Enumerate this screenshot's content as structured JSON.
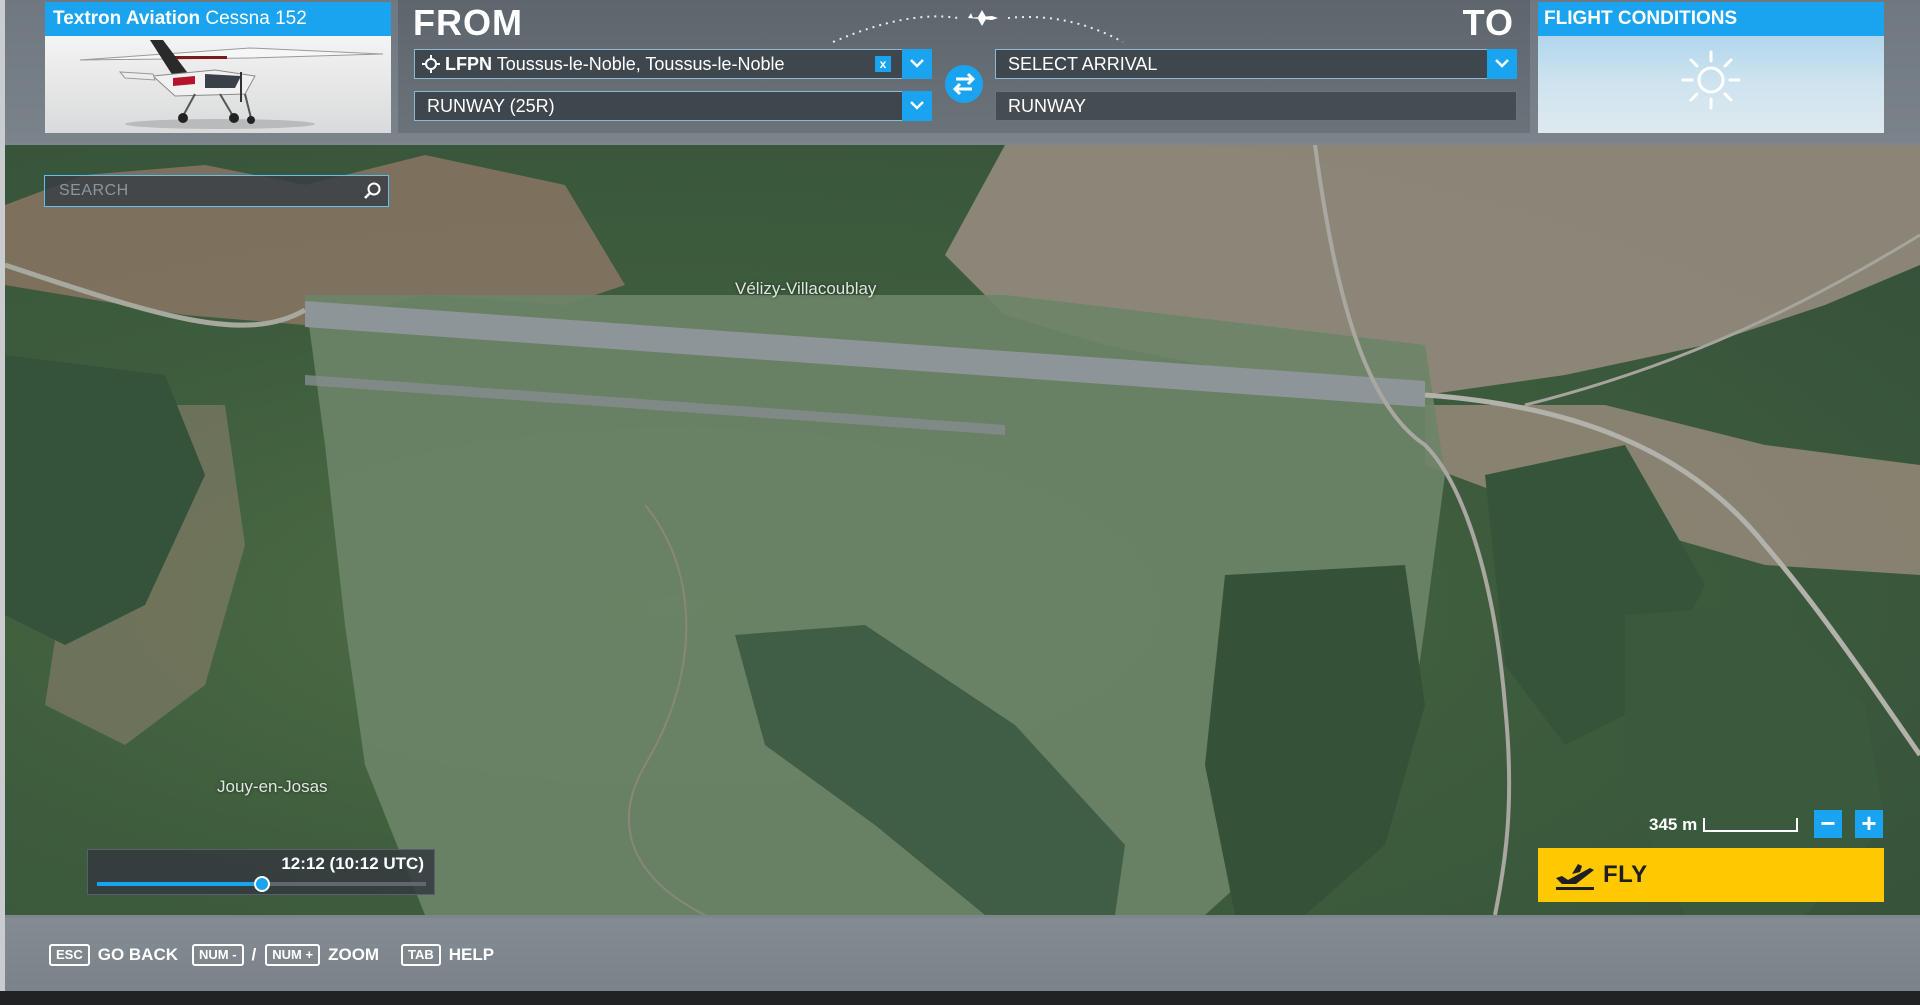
{
  "aircraft": {
    "brand": "Textron Aviation",
    "model": "Cessna 152"
  },
  "route": {
    "from_label": "FROM",
    "to_label": "TO",
    "departure": {
      "code": "LFPN",
      "name": "Toussus-le-Noble, Toussus-le-Noble",
      "clear_label": "x"
    },
    "departure_runway": "RUNWAY (25R)",
    "arrival_placeholder": "SELECT ARRIVAL",
    "arrival_runway": "RUNWAY"
  },
  "conditions": {
    "title": "FLIGHT CONDITIONS",
    "weather_icon": "sun-icon"
  },
  "map": {
    "search_placeholder": "SEARCH",
    "places": [
      "Vélizy-Villacoublay",
      "Jouy-en-Josas"
    ],
    "time_text": "12:12 (10:12 UTC)",
    "time_progress": 0.5,
    "scale_text": "345 m",
    "zoom_out_label": "−",
    "zoom_in_label": "+"
  },
  "fly": {
    "label": "FLY"
  },
  "hints": {
    "back_key": "ESC",
    "back_label": "GO BACK",
    "zoom_out_key": "NUM -",
    "zoom_sep": "/",
    "zoom_in_key": "NUM +",
    "zoom_label": "ZOOM",
    "help_key": "TAB",
    "help_label": "HELP"
  },
  "colors": {
    "accent": "#1aa3ee",
    "fly": "#ffc800"
  }
}
